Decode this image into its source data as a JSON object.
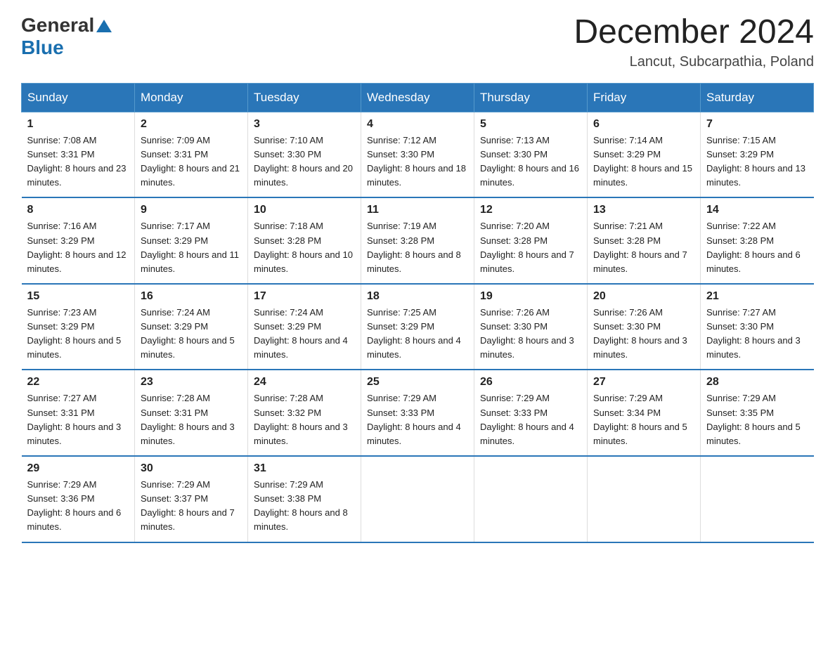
{
  "header": {
    "logo_general": "General",
    "logo_blue": "Blue",
    "month_title": "December 2024",
    "location": "Lancut, Subcarpathia, Poland"
  },
  "days_of_week": [
    "Sunday",
    "Monday",
    "Tuesday",
    "Wednesday",
    "Thursday",
    "Friday",
    "Saturday"
  ],
  "weeks": [
    [
      {
        "day": "1",
        "sunrise": "Sunrise: 7:08 AM",
        "sunset": "Sunset: 3:31 PM",
        "daylight": "Daylight: 8 hours and 23 minutes."
      },
      {
        "day": "2",
        "sunrise": "Sunrise: 7:09 AM",
        "sunset": "Sunset: 3:31 PM",
        "daylight": "Daylight: 8 hours and 21 minutes."
      },
      {
        "day": "3",
        "sunrise": "Sunrise: 7:10 AM",
        "sunset": "Sunset: 3:30 PM",
        "daylight": "Daylight: 8 hours and 20 minutes."
      },
      {
        "day": "4",
        "sunrise": "Sunrise: 7:12 AM",
        "sunset": "Sunset: 3:30 PM",
        "daylight": "Daylight: 8 hours and 18 minutes."
      },
      {
        "day": "5",
        "sunrise": "Sunrise: 7:13 AM",
        "sunset": "Sunset: 3:30 PM",
        "daylight": "Daylight: 8 hours and 16 minutes."
      },
      {
        "day": "6",
        "sunrise": "Sunrise: 7:14 AM",
        "sunset": "Sunset: 3:29 PM",
        "daylight": "Daylight: 8 hours and 15 minutes."
      },
      {
        "day": "7",
        "sunrise": "Sunrise: 7:15 AM",
        "sunset": "Sunset: 3:29 PM",
        "daylight": "Daylight: 8 hours and 13 minutes."
      }
    ],
    [
      {
        "day": "8",
        "sunrise": "Sunrise: 7:16 AM",
        "sunset": "Sunset: 3:29 PM",
        "daylight": "Daylight: 8 hours and 12 minutes."
      },
      {
        "day": "9",
        "sunrise": "Sunrise: 7:17 AM",
        "sunset": "Sunset: 3:29 PM",
        "daylight": "Daylight: 8 hours and 11 minutes."
      },
      {
        "day": "10",
        "sunrise": "Sunrise: 7:18 AM",
        "sunset": "Sunset: 3:28 PM",
        "daylight": "Daylight: 8 hours and 10 minutes."
      },
      {
        "day": "11",
        "sunrise": "Sunrise: 7:19 AM",
        "sunset": "Sunset: 3:28 PM",
        "daylight": "Daylight: 8 hours and 8 minutes."
      },
      {
        "day": "12",
        "sunrise": "Sunrise: 7:20 AM",
        "sunset": "Sunset: 3:28 PM",
        "daylight": "Daylight: 8 hours and 7 minutes."
      },
      {
        "day": "13",
        "sunrise": "Sunrise: 7:21 AM",
        "sunset": "Sunset: 3:28 PM",
        "daylight": "Daylight: 8 hours and 7 minutes."
      },
      {
        "day": "14",
        "sunrise": "Sunrise: 7:22 AM",
        "sunset": "Sunset: 3:28 PM",
        "daylight": "Daylight: 8 hours and 6 minutes."
      }
    ],
    [
      {
        "day": "15",
        "sunrise": "Sunrise: 7:23 AM",
        "sunset": "Sunset: 3:29 PM",
        "daylight": "Daylight: 8 hours and 5 minutes."
      },
      {
        "day": "16",
        "sunrise": "Sunrise: 7:24 AM",
        "sunset": "Sunset: 3:29 PM",
        "daylight": "Daylight: 8 hours and 5 minutes."
      },
      {
        "day": "17",
        "sunrise": "Sunrise: 7:24 AM",
        "sunset": "Sunset: 3:29 PM",
        "daylight": "Daylight: 8 hours and 4 minutes."
      },
      {
        "day": "18",
        "sunrise": "Sunrise: 7:25 AM",
        "sunset": "Sunset: 3:29 PM",
        "daylight": "Daylight: 8 hours and 4 minutes."
      },
      {
        "day": "19",
        "sunrise": "Sunrise: 7:26 AM",
        "sunset": "Sunset: 3:30 PM",
        "daylight": "Daylight: 8 hours and 3 minutes."
      },
      {
        "day": "20",
        "sunrise": "Sunrise: 7:26 AM",
        "sunset": "Sunset: 3:30 PM",
        "daylight": "Daylight: 8 hours and 3 minutes."
      },
      {
        "day": "21",
        "sunrise": "Sunrise: 7:27 AM",
        "sunset": "Sunset: 3:30 PM",
        "daylight": "Daylight: 8 hours and 3 minutes."
      }
    ],
    [
      {
        "day": "22",
        "sunrise": "Sunrise: 7:27 AM",
        "sunset": "Sunset: 3:31 PM",
        "daylight": "Daylight: 8 hours and 3 minutes."
      },
      {
        "day": "23",
        "sunrise": "Sunrise: 7:28 AM",
        "sunset": "Sunset: 3:31 PM",
        "daylight": "Daylight: 8 hours and 3 minutes."
      },
      {
        "day": "24",
        "sunrise": "Sunrise: 7:28 AM",
        "sunset": "Sunset: 3:32 PM",
        "daylight": "Daylight: 8 hours and 3 minutes."
      },
      {
        "day": "25",
        "sunrise": "Sunrise: 7:29 AM",
        "sunset": "Sunset: 3:33 PM",
        "daylight": "Daylight: 8 hours and 4 minutes."
      },
      {
        "day": "26",
        "sunrise": "Sunrise: 7:29 AM",
        "sunset": "Sunset: 3:33 PM",
        "daylight": "Daylight: 8 hours and 4 minutes."
      },
      {
        "day": "27",
        "sunrise": "Sunrise: 7:29 AM",
        "sunset": "Sunset: 3:34 PM",
        "daylight": "Daylight: 8 hours and 5 minutes."
      },
      {
        "day": "28",
        "sunrise": "Sunrise: 7:29 AM",
        "sunset": "Sunset: 3:35 PM",
        "daylight": "Daylight: 8 hours and 5 minutes."
      }
    ],
    [
      {
        "day": "29",
        "sunrise": "Sunrise: 7:29 AM",
        "sunset": "Sunset: 3:36 PM",
        "daylight": "Daylight: 8 hours and 6 minutes."
      },
      {
        "day": "30",
        "sunrise": "Sunrise: 7:29 AM",
        "sunset": "Sunset: 3:37 PM",
        "daylight": "Daylight: 8 hours and 7 minutes."
      },
      {
        "day": "31",
        "sunrise": "Sunrise: 7:29 AM",
        "sunset": "Sunset: 3:38 PM",
        "daylight": "Daylight: 8 hours and 8 minutes."
      },
      {
        "day": "",
        "sunrise": "",
        "sunset": "",
        "daylight": ""
      },
      {
        "day": "",
        "sunrise": "",
        "sunset": "",
        "daylight": ""
      },
      {
        "day": "",
        "sunrise": "",
        "sunset": "",
        "daylight": ""
      },
      {
        "day": "",
        "sunrise": "",
        "sunset": "",
        "daylight": ""
      }
    ]
  ]
}
